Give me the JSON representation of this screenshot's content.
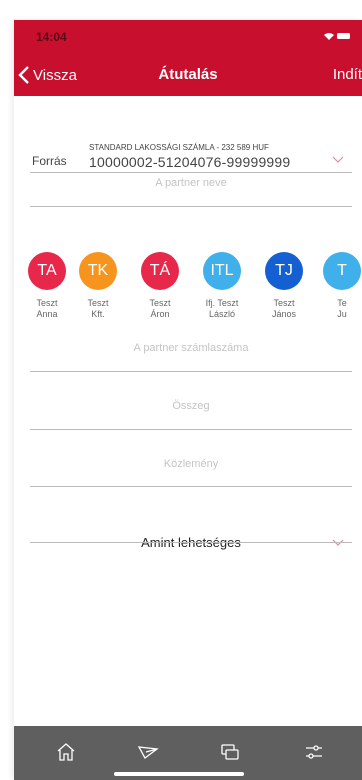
{
  "status": {
    "time": "14:04"
  },
  "nav": {
    "back": "Vissza",
    "title": "Átutalás",
    "start": "Indít"
  },
  "source": {
    "label": "Forrás",
    "account_name": "STANDARD LAKOSSÁGI SZÁMLA - 232 589 HUF",
    "account_number": "10000002-51204076-99999999"
  },
  "form": {
    "partner_name_placeholder": "A partner neve",
    "account_placeholder": "A partner számlaszáma",
    "amount_placeholder": "Összeg",
    "comment_placeholder": "Közlemény",
    "schedule_value": "Amint lehetséges"
  },
  "partners": [
    {
      "initials": "TA",
      "line1": "Teszt",
      "line2": "Anna",
      "color": "#e8284a"
    },
    {
      "initials": "TK",
      "line1": "Teszt",
      "line2": "Kft.",
      "color": "#f7941d"
    },
    {
      "initials": "TÁ",
      "line1": "Teszt",
      "line2": "Áron",
      "color": "#e8284a"
    },
    {
      "initials": "ITL",
      "line1": "Ifj. Teszt",
      "line2": "László",
      "color": "#3fb0ea"
    },
    {
      "initials": "TJ",
      "line1": "Teszt",
      "line2": "János",
      "color": "#1460d2"
    },
    {
      "initials": "T",
      "line1": "Te",
      "line2": "Ju",
      "color": "#3fb0ea"
    }
  ],
  "colors": {
    "header": "#c8102e",
    "tabbar": "#5f5f5f",
    "chevron": "#e78a9a"
  },
  "tabs": [
    "home-icon",
    "send-icon",
    "cards-icon",
    "settings-icon"
  ]
}
